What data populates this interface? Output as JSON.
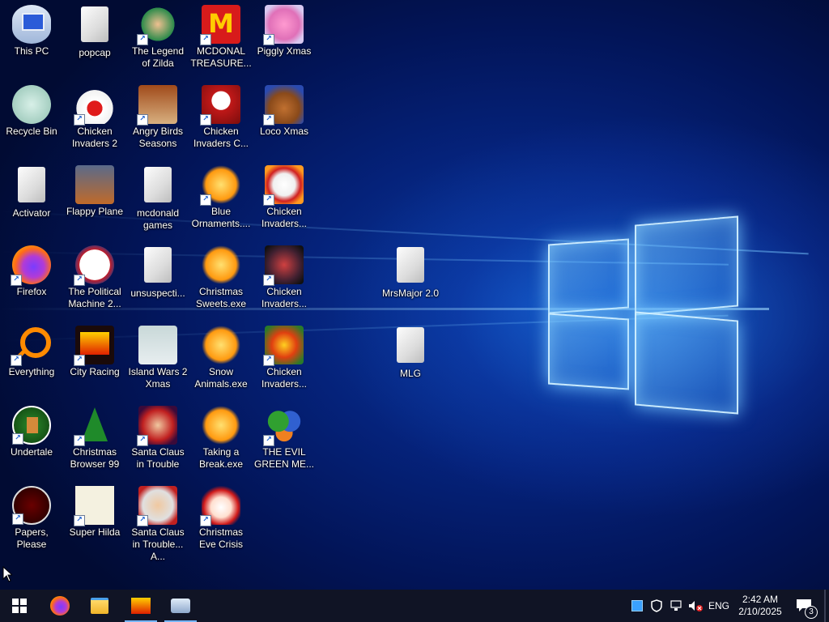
{
  "desktop": {
    "icons": [
      {
        "label": "This PC",
        "icon": "computer-icon",
        "shortcut": false
      },
      {
        "label": "Recycle Bin",
        "icon": "recycle-bin-icon",
        "shortcut": false
      },
      {
        "label": "Activator",
        "icon": "file-icon",
        "shortcut": false
      },
      {
        "label": "Firefox",
        "icon": "firefox-icon",
        "shortcut": true
      },
      {
        "label": "Everything",
        "icon": "magnifier-icon",
        "shortcut": true
      },
      {
        "label": "Undertale",
        "icon": "undertale-icon",
        "shortcut": true
      },
      {
        "label": "Papers, Please",
        "icon": "papers-please-icon",
        "shortcut": true
      },
      {
        "label": "popcap",
        "icon": "folder-icon",
        "shortcut": false
      },
      {
        "label": "Chicken Invaders 2",
        "icon": "chicken-icon",
        "shortcut": true
      },
      {
        "label": "Flappy Plane",
        "icon": "game-icon",
        "shortcut": false
      },
      {
        "label": "The Political Machine 2...",
        "icon": "political-machine-icon",
        "shortcut": true
      },
      {
        "label": "City Racing",
        "icon": "city-racer-icon",
        "shortcut": true
      },
      {
        "label": "Christmas Browser 99",
        "icon": "christmas-tree-icon",
        "shortcut": true
      },
      {
        "label": "Super Hilda",
        "icon": "pixel-dog-icon",
        "shortcut": true
      },
      {
        "label": "The Legend of Zilda",
        "icon": "zilda-icon",
        "shortcut": true
      },
      {
        "label": "Angry Birds Seasons",
        "icon": "angry-birds-icon",
        "shortcut": true
      },
      {
        "label": "mcdonald games",
        "icon": "folder-icon",
        "shortcut": false
      },
      {
        "label": "unsuspecti...",
        "icon": "folder-icon",
        "shortcut": false
      },
      {
        "label": "Island Wars 2 Xmas",
        "icon": "island-wars-icon",
        "shortcut": false
      },
      {
        "label": "Santa Claus in Trouble",
        "icon": "santa-icon",
        "shortcut": true
      },
      {
        "label": "Santa Claus in Trouble... A...",
        "icon": "santa-icon",
        "shortcut": true
      },
      {
        "label": "MCDONAL TREASURE...",
        "icon": "mcdonalds-icon",
        "shortcut": true
      },
      {
        "label": "Chicken Invaders C...",
        "icon": "snowman-icon",
        "shortcut": true
      },
      {
        "label": "Blue Ornaments....",
        "icon": "star-puzzle-icon",
        "shortcut": true
      },
      {
        "label": "Christmas Sweets.exe",
        "icon": "star-puzzle-icon",
        "shortcut": false
      },
      {
        "label": "Snow Animals.exe",
        "icon": "star-puzzle-icon",
        "shortcut": false
      },
      {
        "label": "Taking a Break.exe",
        "icon": "star-puzzle-icon",
        "shortcut": false
      },
      {
        "label": "Christmas Eve Crisis",
        "icon": "santa-face-icon",
        "shortcut": true
      },
      {
        "label": "Piggly Xmas",
        "icon": "pig-icon",
        "shortcut": true
      },
      {
        "label": "Loco Xmas",
        "icon": "teddy-bear-icon",
        "shortcut": true
      },
      {
        "label": "Chicken Invaders...",
        "icon": "chicken-icon",
        "shortcut": true
      },
      {
        "label": "Chicken Invaders...",
        "icon": "chicken-icon",
        "shortcut": true
      },
      {
        "label": "Chicken Invaders...",
        "icon": "chicken-icon",
        "shortcut": true
      },
      {
        "label": "THE EVIL GREEN ME...",
        "icon": "messenger-icon",
        "shortcut": true
      },
      {
        "label": "MrsMajor 2.0",
        "icon": "folder-icon",
        "shortcut": false
      },
      {
        "label": "MLG",
        "icon": "folder-icon",
        "shortcut": false
      }
    ]
  },
  "taskbar": {
    "start_icon": "windows-logo-icon",
    "pinned": [
      {
        "name": "firefox",
        "icon": "firefox-icon",
        "active": false
      },
      {
        "name": "file-explorer",
        "icon": "folder-icon",
        "active": false
      },
      {
        "name": "city-racing",
        "icon": "city-racer-icon",
        "active": true
      },
      {
        "name": "control-panel",
        "icon": "computer-icon",
        "active": true
      }
    ],
    "tray": {
      "language": "ENG",
      "time": "2:42 AM",
      "date": "2/10/2025",
      "notification_count": "3"
    }
  },
  "colors": {
    "taskbar_bg": "#101425",
    "wallpaper_glow": "#3aa0ff",
    "accent": "#77b6ff"
  }
}
